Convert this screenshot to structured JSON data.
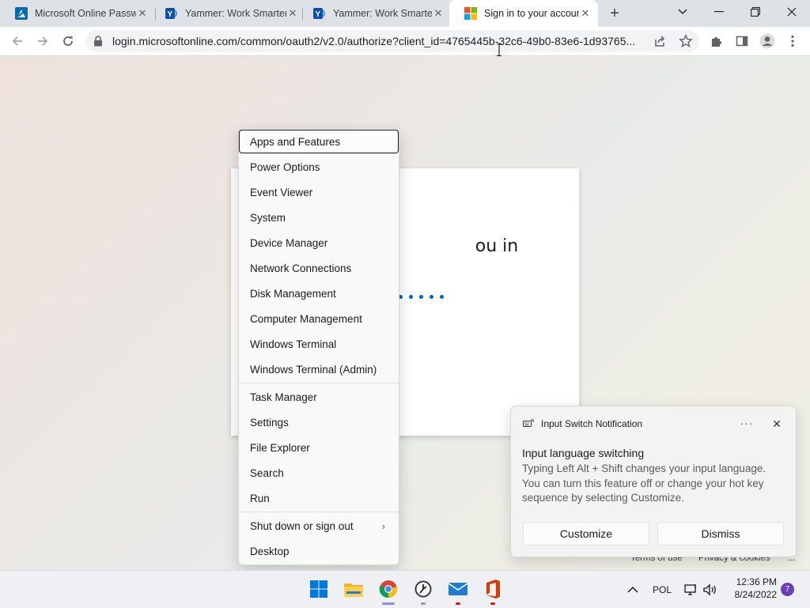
{
  "browser": {
    "tabs": [
      {
        "title": "Microsoft Online Passw",
        "icon": "azure-tab-icon",
        "active": false
      },
      {
        "title": "Yammer: Work Smarter",
        "icon": "yammer-tab-icon",
        "active": false
      },
      {
        "title": "Yammer: Work Smarter",
        "icon": "yammer-tab-icon",
        "active": false
      },
      {
        "title": "Sign in to your account",
        "icon": "microsoft-logo-icon",
        "active": true
      }
    ],
    "url": "login.microsoftonline.com/common/oauth2/v2.0/authorize?client_id=4765445b-32c6-49b0-83e6-1d93765...",
    "accent": "#1a73e8"
  },
  "page": {
    "heading_partial": "ou in",
    "footer": {
      "terms": "Terms of use",
      "privacy": "Privacy & cookies",
      "more": "..."
    }
  },
  "winx_menu": {
    "items": [
      {
        "label": "Apps and Features",
        "focused": true
      },
      {
        "label": "Power Options"
      },
      {
        "label": "Event Viewer"
      },
      {
        "label": "System"
      },
      {
        "label": "Device Manager"
      },
      {
        "label": "Network Connections"
      },
      {
        "label": "Disk Management"
      },
      {
        "label": "Computer Management"
      },
      {
        "label": "Windows Terminal"
      },
      {
        "label": "Windows Terminal (Admin)"
      },
      {
        "label": "Task Manager"
      },
      {
        "label": "Settings"
      },
      {
        "label": "File Explorer"
      },
      {
        "label": "Search"
      },
      {
        "label": "Run"
      },
      {
        "label": "Shut down or sign out",
        "submenu": true
      },
      {
        "label": "Desktop"
      }
    ]
  },
  "toast": {
    "app_name": "Input Switch Notification",
    "title": "Input language switching",
    "body": "Typing Left Alt + Shift changes your input language. You can turn this feature off or change your hot key sequence by selecting Customize.",
    "more": "···",
    "buttons": {
      "customize": "Customize",
      "dismiss": "Dismiss"
    }
  },
  "taskbar": {
    "apps": [
      "windows-start-icon",
      "file-explorer-icon",
      "chrome-icon",
      "clock-app-icon",
      "mail-icon",
      "office-icon"
    ],
    "tray": {
      "language": "POL",
      "time": "12:36 PM",
      "date": "8/24/2022",
      "notifications": "7"
    }
  }
}
